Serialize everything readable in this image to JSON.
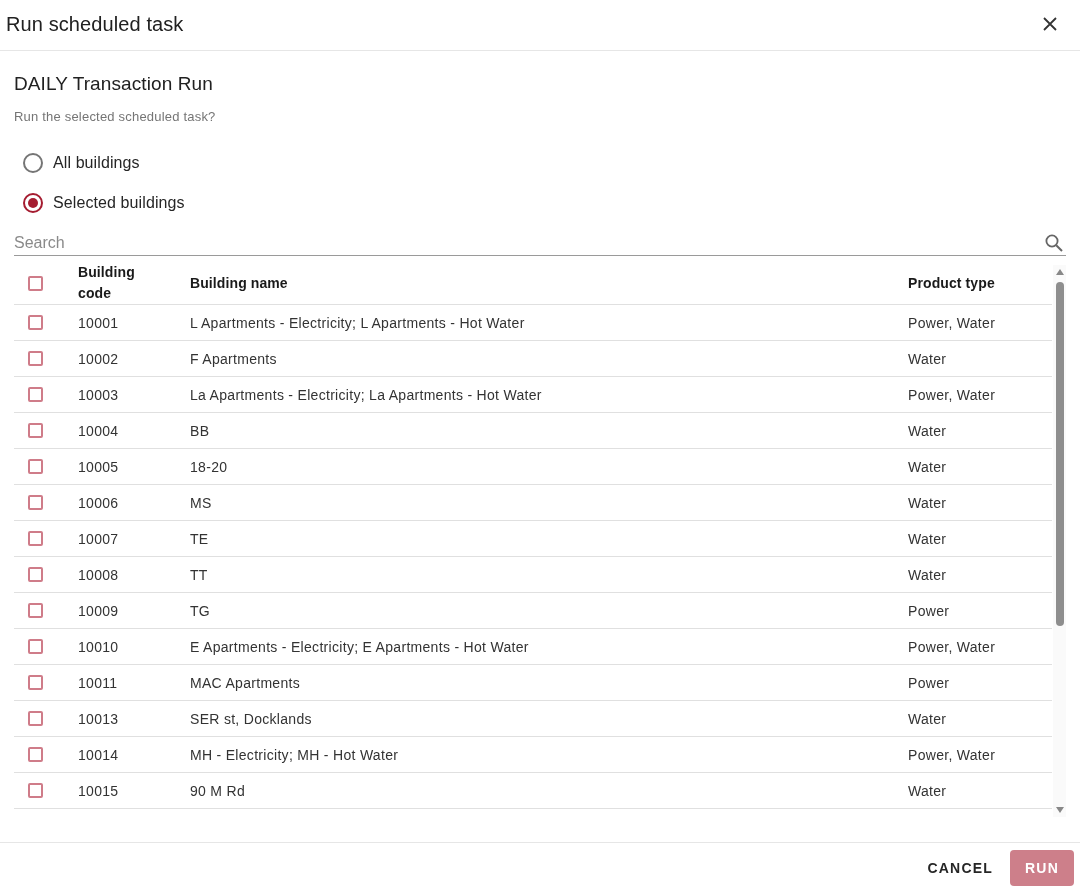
{
  "dialog": {
    "title": "Run scheduled task"
  },
  "task": {
    "name": "DAILY Transaction Run",
    "prompt": "Run the selected scheduled task?"
  },
  "scope_options": [
    {
      "label": "All buildings",
      "selected": false
    },
    {
      "label": "Selected buildings",
      "selected": true
    }
  ],
  "search": {
    "placeholder": "Search"
  },
  "table": {
    "select_all_checked": false,
    "columns": [
      "Building code",
      "Building name",
      "Product type"
    ],
    "rows": [
      {
        "checked": false,
        "code": "10001",
        "name": "L Apartments - Electricity; L Apartments - Hot Water",
        "product_type": "Power, Water"
      },
      {
        "checked": false,
        "code": "10002",
        "name": "F Apartments",
        "product_type": "Water"
      },
      {
        "checked": false,
        "code": "10003",
        "name": "La Apartments - Electricity; La Apartments - Hot Water",
        "product_type": "Power, Water"
      },
      {
        "checked": false,
        "code": "10004",
        "name": "BB",
        "product_type": "Water"
      },
      {
        "checked": false,
        "code": "10005",
        "name": "18-20",
        "product_type": "Water"
      },
      {
        "checked": false,
        "code": "10006",
        "name": "MS",
        "product_type": "Water"
      },
      {
        "checked": false,
        "code": "10007",
        "name": "TE",
        "product_type": "Water"
      },
      {
        "checked": false,
        "code": "10008",
        "name": "TT",
        "product_type": "Water"
      },
      {
        "checked": false,
        "code": "10009",
        "name": "TG",
        "product_type": "Power"
      },
      {
        "checked": false,
        "code": "10010",
        "name": "E Apartments - Electricity; E Apartments - Hot Water",
        "product_type": "Power, Water"
      },
      {
        "checked": false,
        "code": "10011",
        "name": "MAC Apartments",
        "product_type": "Power"
      },
      {
        "checked": false,
        "code": "10013",
        "name": "SER st, Docklands",
        "product_type": "Water"
      },
      {
        "checked": false,
        "code": "10014",
        "name": "MH - Electricity; MH - Hot Water",
        "product_type": "Power, Water"
      },
      {
        "checked": false,
        "code": "10015",
        "name": "90 M Rd",
        "product_type": "Water"
      }
    ]
  },
  "buttons": [
    {
      "label": "CANCEL",
      "kind": "text",
      "disabled": false
    },
    {
      "label": "RUN",
      "kind": "primary",
      "disabled": true
    }
  ]
}
